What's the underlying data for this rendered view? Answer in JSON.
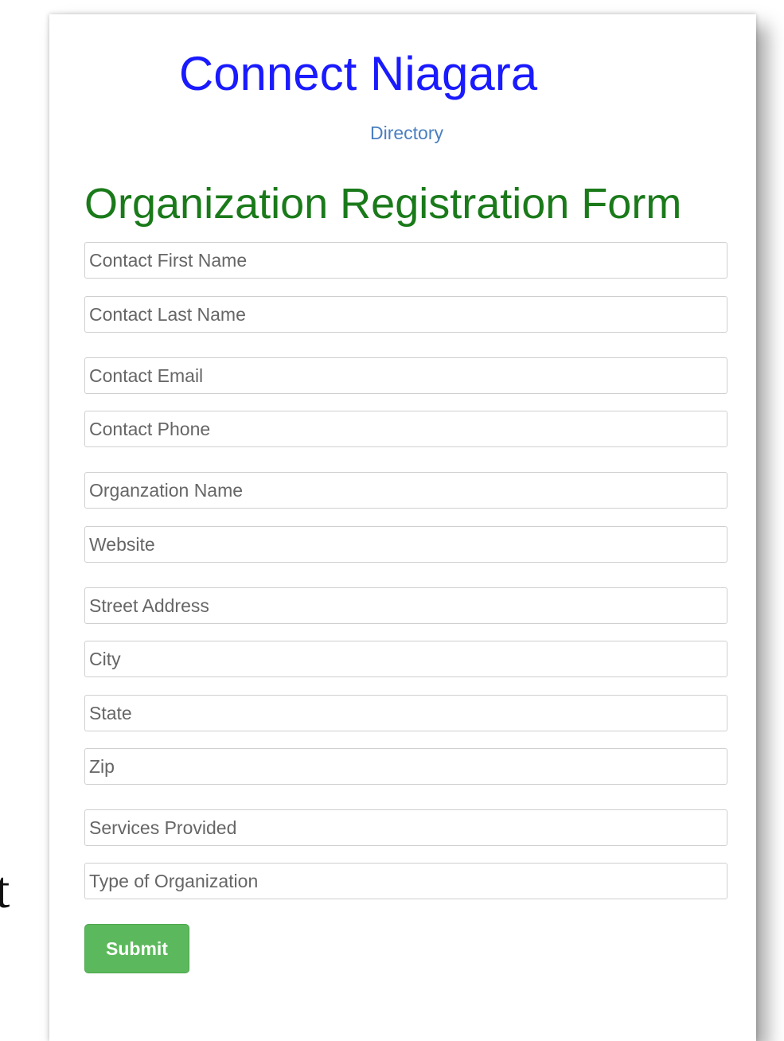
{
  "backdrop": {
    "fragment": "t"
  },
  "header": {
    "site_title": "Connect Niagara",
    "directory_link": "Directory"
  },
  "form": {
    "title": "Organization Registration Form",
    "fields": [
      {
        "placeholder": "Contact First Name"
      },
      {
        "placeholder": "Contact Last Name"
      },
      {
        "placeholder": "Contact Email"
      },
      {
        "placeholder": "Contact Phone"
      },
      {
        "placeholder": "Organzation Name"
      },
      {
        "placeholder": "Website"
      },
      {
        "placeholder": "Street Address"
      },
      {
        "placeholder": "City"
      },
      {
        "placeholder": "State"
      },
      {
        "placeholder": "Zip"
      },
      {
        "placeholder": "Services Provided"
      },
      {
        "placeholder": "Type of Organization"
      }
    ],
    "submit_label": "Submit"
  },
  "colors": {
    "site_title": "#1a1aff",
    "form_title": "#1a7a1a",
    "link": "#4a7fc1",
    "submit_bg": "#5cb85c"
  }
}
